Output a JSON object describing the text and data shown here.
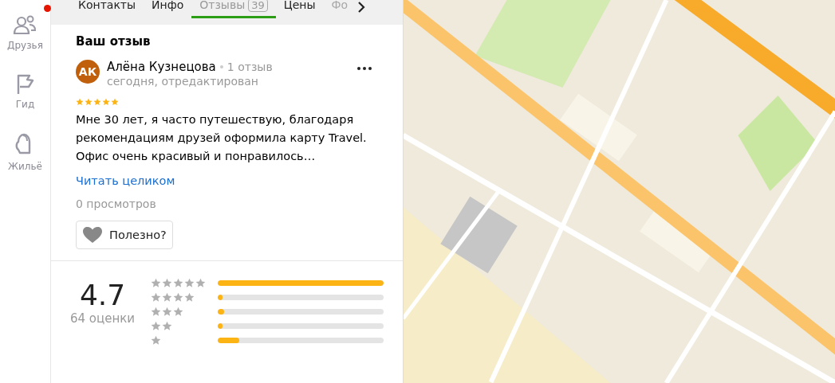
{
  "nav": [
    {
      "kind": "friends",
      "label": "Друзья",
      "badge": true
    },
    {
      "kind": "guide",
      "label": "Гид",
      "badge": false
    },
    {
      "kind": "housing",
      "label": "Жильё",
      "badge": false
    }
  ],
  "tabs": [
    {
      "label": "Контакты",
      "selected": false
    },
    {
      "label": "Инфо",
      "selected": false
    },
    {
      "label": "Отзывы",
      "count": "39",
      "selected": true
    },
    {
      "label": "Цены",
      "selected": false
    },
    {
      "label": "Фо",
      "faded": true,
      "selected": false
    }
  ],
  "review": {
    "heading": "Ваш отзыв",
    "avatar": "АК",
    "author": "Алёна Кузнецова",
    "author_reviews": "1 отзыв",
    "date": "сегодня, отредактирован",
    "stars": 5,
    "text": "Мне 30 лет, я часто путешествую, благодаря рекомендациям друзей оформила карту Travel. Офис очень красивый и понравилось…",
    "read_more": "Читать целиком",
    "views": "0 просмотров",
    "helpful": "Полезно?"
  },
  "rating": {
    "score": "4.7",
    "count": "64 оценки",
    "rows": [
      {
        "level": 1.0
      },
      {
        "level": 0.02
      },
      {
        "level": 0.04
      },
      {
        "level": 0.02
      },
      {
        "level": 0.13
      }
    ]
  }
}
